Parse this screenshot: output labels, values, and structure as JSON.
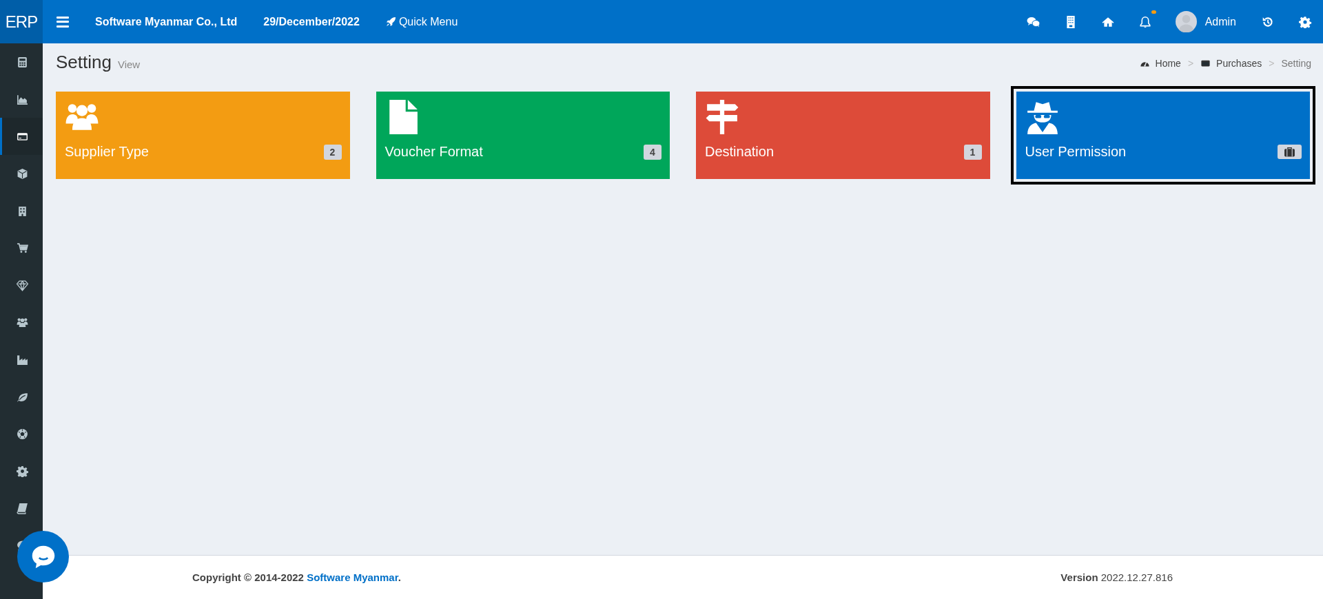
{
  "header": {
    "logo": "ERP",
    "company": "Software Myanmar Co., Ltd",
    "date": "29/December/2022",
    "quick_menu": "Quick Menu",
    "notification_dot": true,
    "user": "Admin"
  },
  "sidebar": {
    "items": [
      {
        "kind": "calculator",
        "selected": false
      },
      {
        "kind": "area-chart",
        "selected": false
      },
      {
        "kind": "card",
        "selected": true
      },
      {
        "kind": "cube",
        "selected": false
      },
      {
        "kind": "building",
        "selected": false
      },
      {
        "kind": "cart",
        "selected": false
      },
      {
        "kind": "diamond",
        "selected": false
      },
      {
        "kind": "users",
        "selected": false
      },
      {
        "kind": "factory",
        "selected": false
      },
      {
        "kind": "leaf",
        "selected": false
      },
      {
        "kind": "ball",
        "selected": false
      },
      {
        "kind": "gear",
        "selected": false
      },
      {
        "kind": "book",
        "selected": false
      },
      {
        "kind": "chat",
        "selected": false
      }
    ]
  },
  "page": {
    "title": "Setting",
    "subtitle": "View"
  },
  "breadcrumb": {
    "separator": ">",
    "items": [
      {
        "label": "Home",
        "kind": "dashboard"
      },
      {
        "label": "Purchases",
        "kind": "card"
      },
      {
        "label": "Setting",
        "kind": "none"
      }
    ]
  },
  "cards": [
    {
      "label": "Supplier Type",
      "kind": "users",
      "badge": "2",
      "color": "#f39c12",
      "selected": false
    },
    {
      "label": "Voucher Format",
      "kind": "file",
      "badge": "4",
      "color": "#00a65a",
      "selected": false
    },
    {
      "label": "Destination",
      "kind": "signpost",
      "badge": "1",
      "color": "#dd4b39",
      "selected": false
    },
    {
      "label": "User Permission",
      "kind": "spy",
      "badge_icon": true,
      "color": "#0070c8",
      "selected": true
    }
  ],
  "footer": {
    "copyright": "Copyright © 2014-2022",
    "link": "Software Myanmar",
    "link_suffix": ".",
    "version_label": "Version",
    "version": "2022.12.27.816"
  }
}
